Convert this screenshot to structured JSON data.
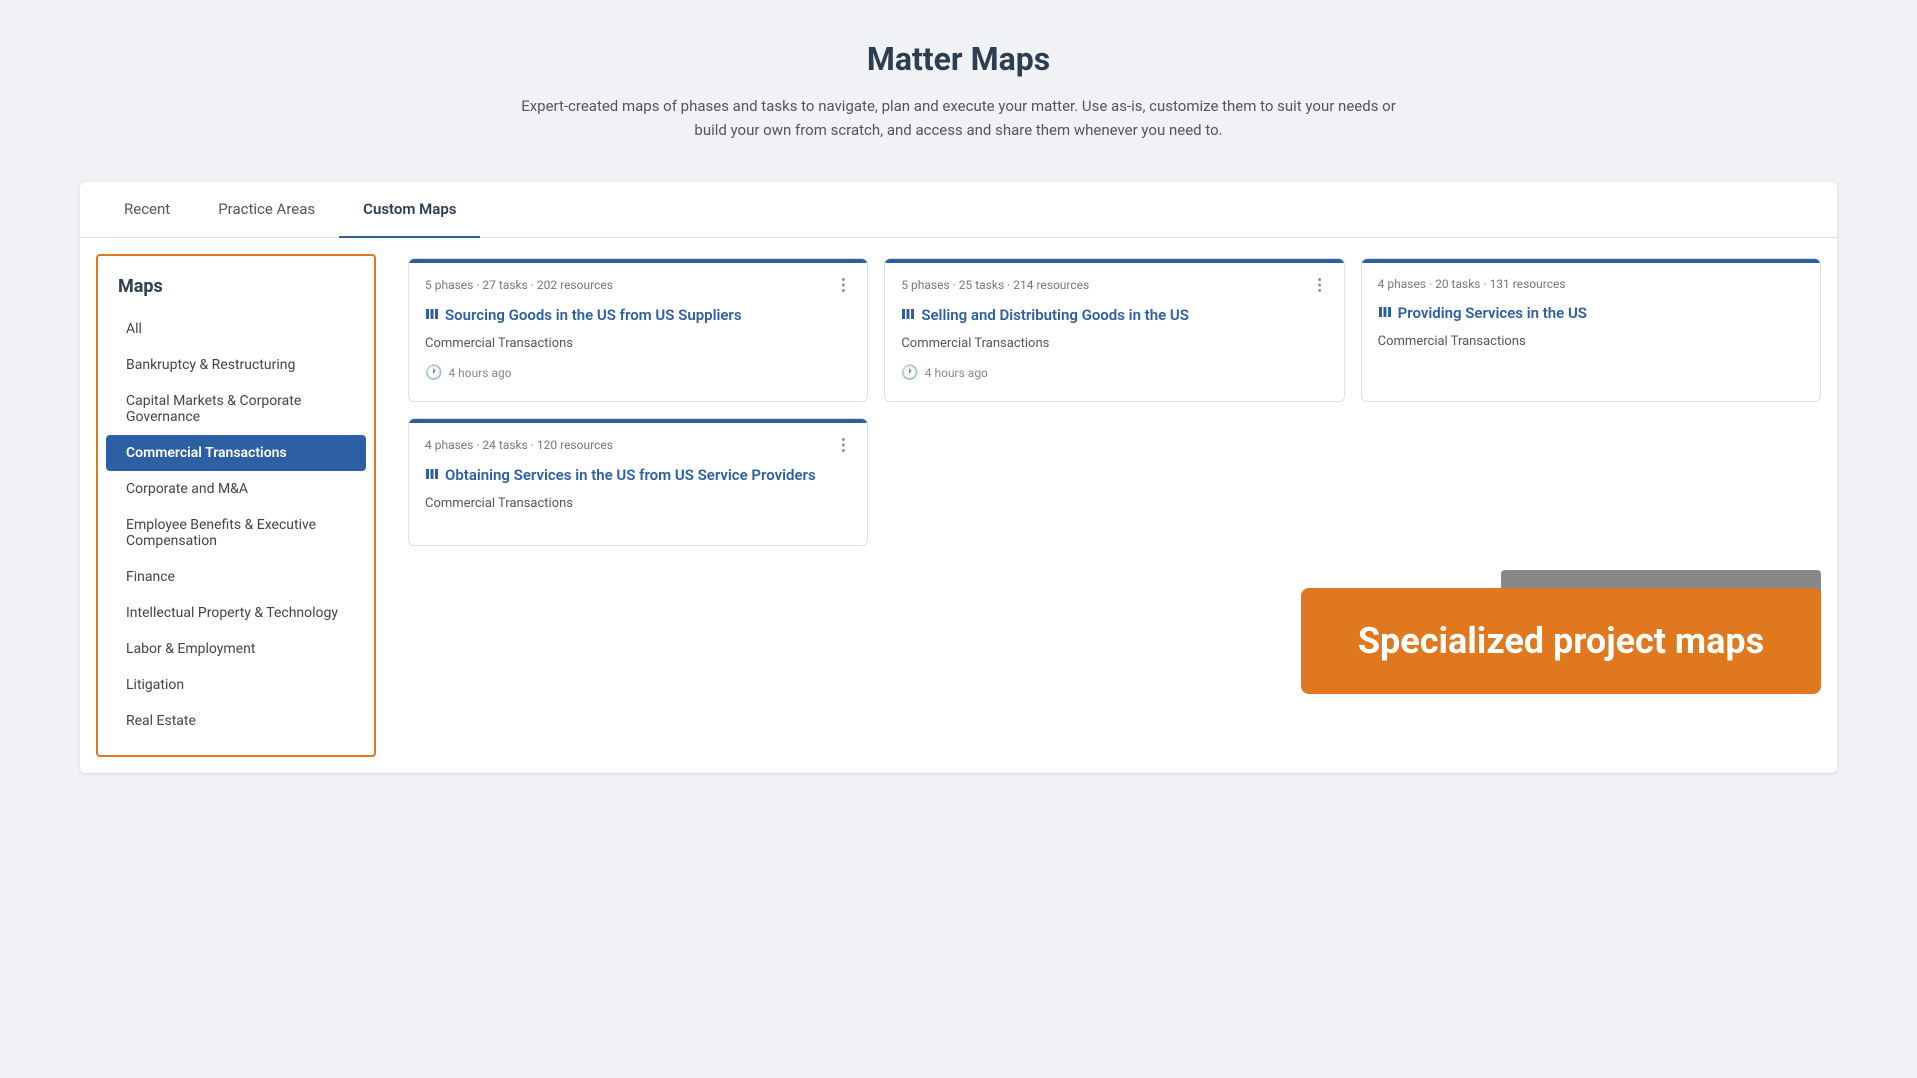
{
  "page": {
    "title": "Matter Maps",
    "subtitle": "Expert-created maps of phases and tasks to navigate, plan and execute your matter. Use as-is, customize them to suit your needs or build your own from scratch, and access and share them whenever you need to."
  },
  "tabs": [
    {
      "id": "recent",
      "label": "Recent",
      "active": false
    },
    {
      "id": "practice-areas",
      "label": "Practice Areas",
      "active": true
    },
    {
      "id": "custom-maps",
      "label": "Custom Maps",
      "active": false
    }
  ],
  "sidebar": {
    "title": "Maps",
    "items": [
      {
        "id": "all",
        "label": "All",
        "active": false
      },
      {
        "id": "bankruptcy",
        "label": "Bankruptcy & Restructuring",
        "active": false
      },
      {
        "id": "capital-markets",
        "label": "Capital Markets & Corporate Governance",
        "active": false
      },
      {
        "id": "commercial-transactions",
        "label": "Commercial Transactions",
        "active": true
      },
      {
        "id": "corporate-ma",
        "label": "Corporate and M&A",
        "active": false
      },
      {
        "id": "employee-benefits",
        "label": "Employee Benefits & Executive Compensation",
        "active": false
      },
      {
        "id": "finance",
        "label": "Finance",
        "active": false
      },
      {
        "id": "intellectual-property",
        "label": "Intellectual Property & Technology",
        "active": false
      },
      {
        "id": "labor-employment",
        "label": "Labor & Employment",
        "active": false
      },
      {
        "id": "litigation",
        "label": "Litigation",
        "active": false
      },
      {
        "id": "real-estate",
        "label": "Real Estate",
        "active": false
      }
    ]
  },
  "cards": [
    {
      "id": "card1",
      "meta": "5 phases · 27 tasks · 202 resources",
      "title": "Sourcing Goods in the US from US Suppliers",
      "category": "Commercial Transactions",
      "time": "4 hours ago",
      "showTime": true
    },
    {
      "id": "card2",
      "meta": "5 phases · 25 tasks · 214 resources",
      "title": "Selling and Distributing Goods in the US",
      "category": "Commercial Transactions",
      "time": "4 hours ago",
      "showTime": true
    },
    {
      "id": "card3",
      "meta": "4 phases · 20 tasks · 131 resources",
      "title": "Providing Services in the US",
      "category": "Commercial Transactions",
      "time": "",
      "showTime": false
    },
    {
      "id": "card4",
      "meta": "4 phases · 24 tasks · 120 resources",
      "title": "Obtaining Services in the US from US Service Providers",
      "category": "Commercial Transactions",
      "time": "",
      "showTime": false
    }
  ],
  "specialized": {
    "banner_text": "Specialized project maps"
  }
}
